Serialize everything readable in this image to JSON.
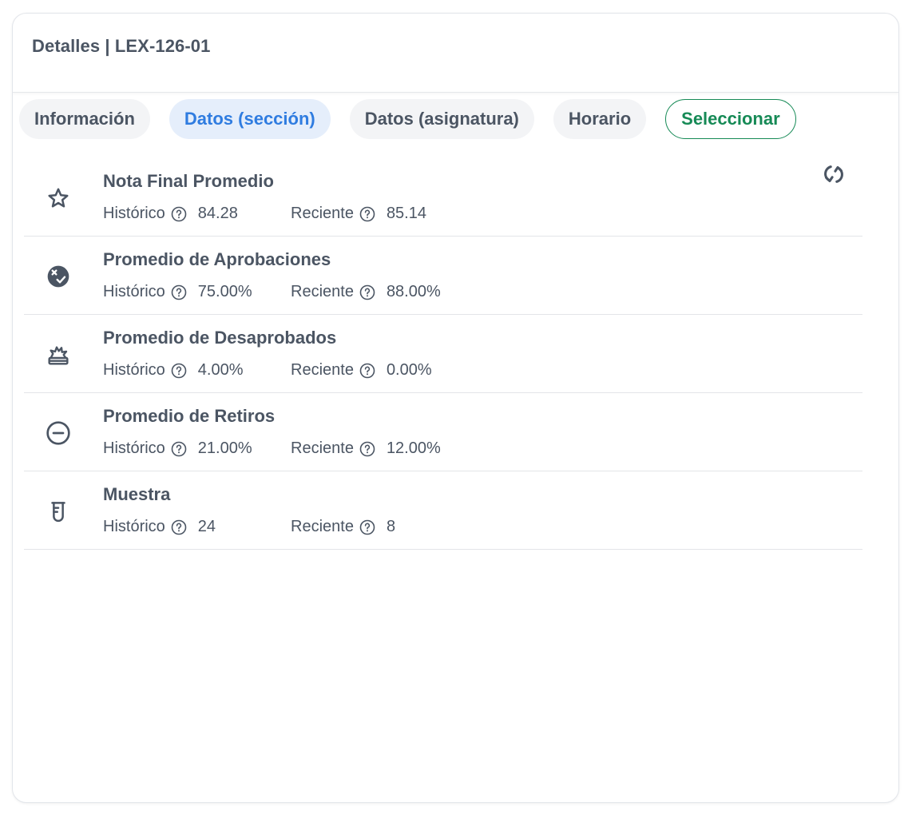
{
  "header": {
    "title": "Detalles | LEX-126-01"
  },
  "tabs": [
    {
      "label": "Información"
    },
    {
      "label": "Datos (sección)"
    },
    {
      "label": "Datos (asignatura)"
    },
    {
      "label": "Horario"
    },
    {
      "label": "Seleccionar"
    }
  ],
  "active_tab": "Datos (sección)",
  "colors": {
    "accent": "#2f7ce0",
    "success": "#168a56",
    "text": "#4b5563"
  },
  "labels": {
    "historico": "Histórico",
    "reciente": "Reciente"
  },
  "metrics": [
    {
      "title": "Nota Final Promedio",
      "icon": "star-icon",
      "historico": "84.28",
      "reciente": "85.14"
    },
    {
      "title": "Promedio de Aprobaciones",
      "icon": "approval-check-icon",
      "historico": "75.00%",
      "reciente": "88.00%"
    },
    {
      "title": "Promedio de Desaprobados",
      "icon": "explosion-icon",
      "historico": "4.00%",
      "reciente": "0.00%"
    },
    {
      "title": "Promedio de Retiros",
      "icon": "minus-circle-icon",
      "historico": "21.00%",
      "reciente": "12.00%"
    },
    {
      "title": "Muestra",
      "icon": "test-tube-icon",
      "historico": "24",
      "reciente": "8"
    }
  ]
}
